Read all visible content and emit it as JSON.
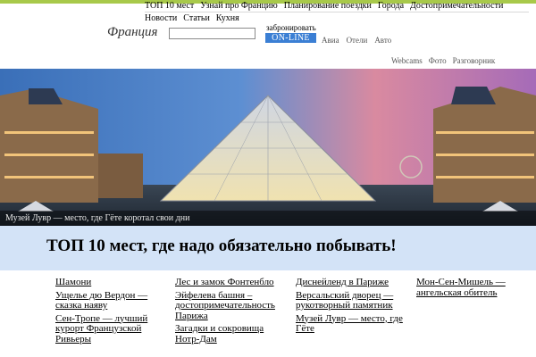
{
  "top_nav": {
    "row1": [
      "ТОП 10 мест",
      "Узнай про Францию",
      "Планирование поездки",
      "Города",
      "Достопримечательности"
    ],
    "row2": [
      "Новости",
      "Статьи",
      "Кухня"
    ]
  },
  "brand": "Франция",
  "search": {
    "value": "",
    "placeholder": ""
  },
  "booking": {
    "label": "забронировать",
    "button": "ON-LINE"
  },
  "services": [
    "Авиа",
    "Отели",
    "Авто"
  ],
  "extras": [
    "Webcams",
    "Фото",
    "Разговорник"
  ],
  "hero": {
    "caption": "Музей Лувр — место, где Гёте коротал свои дни"
  },
  "section": {
    "title": "ТОП 10 мест, где надо обязательно побывать!",
    "columns": [
      [
        "Шамони",
        "Ущелье дю Вердон — сказка наяву",
        "Сен-Тропе — лучший курорт Французской Ривьеры"
      ],
      [
        "Лес и замок Фонтенбло",
        "Эйфелева башня – достопримечательность Парижа",
        "Загадки и сокровища Нотр-Дам"
      ],
      [
        "Диснейленд в Париже",
        "Версальский дворец — рукотворный памятник",
        "Музей Лувр — место, где Гёте"
      ],
      [
        "Мон-Сен-Мишель — ангельская обитель"
      ]
    ]
  },
  "colors": {
    "accent_bar": "#a8c94a",
    "button": "#3b7fd4",
    "section_bg": "#d3e3f7"
  }
}
